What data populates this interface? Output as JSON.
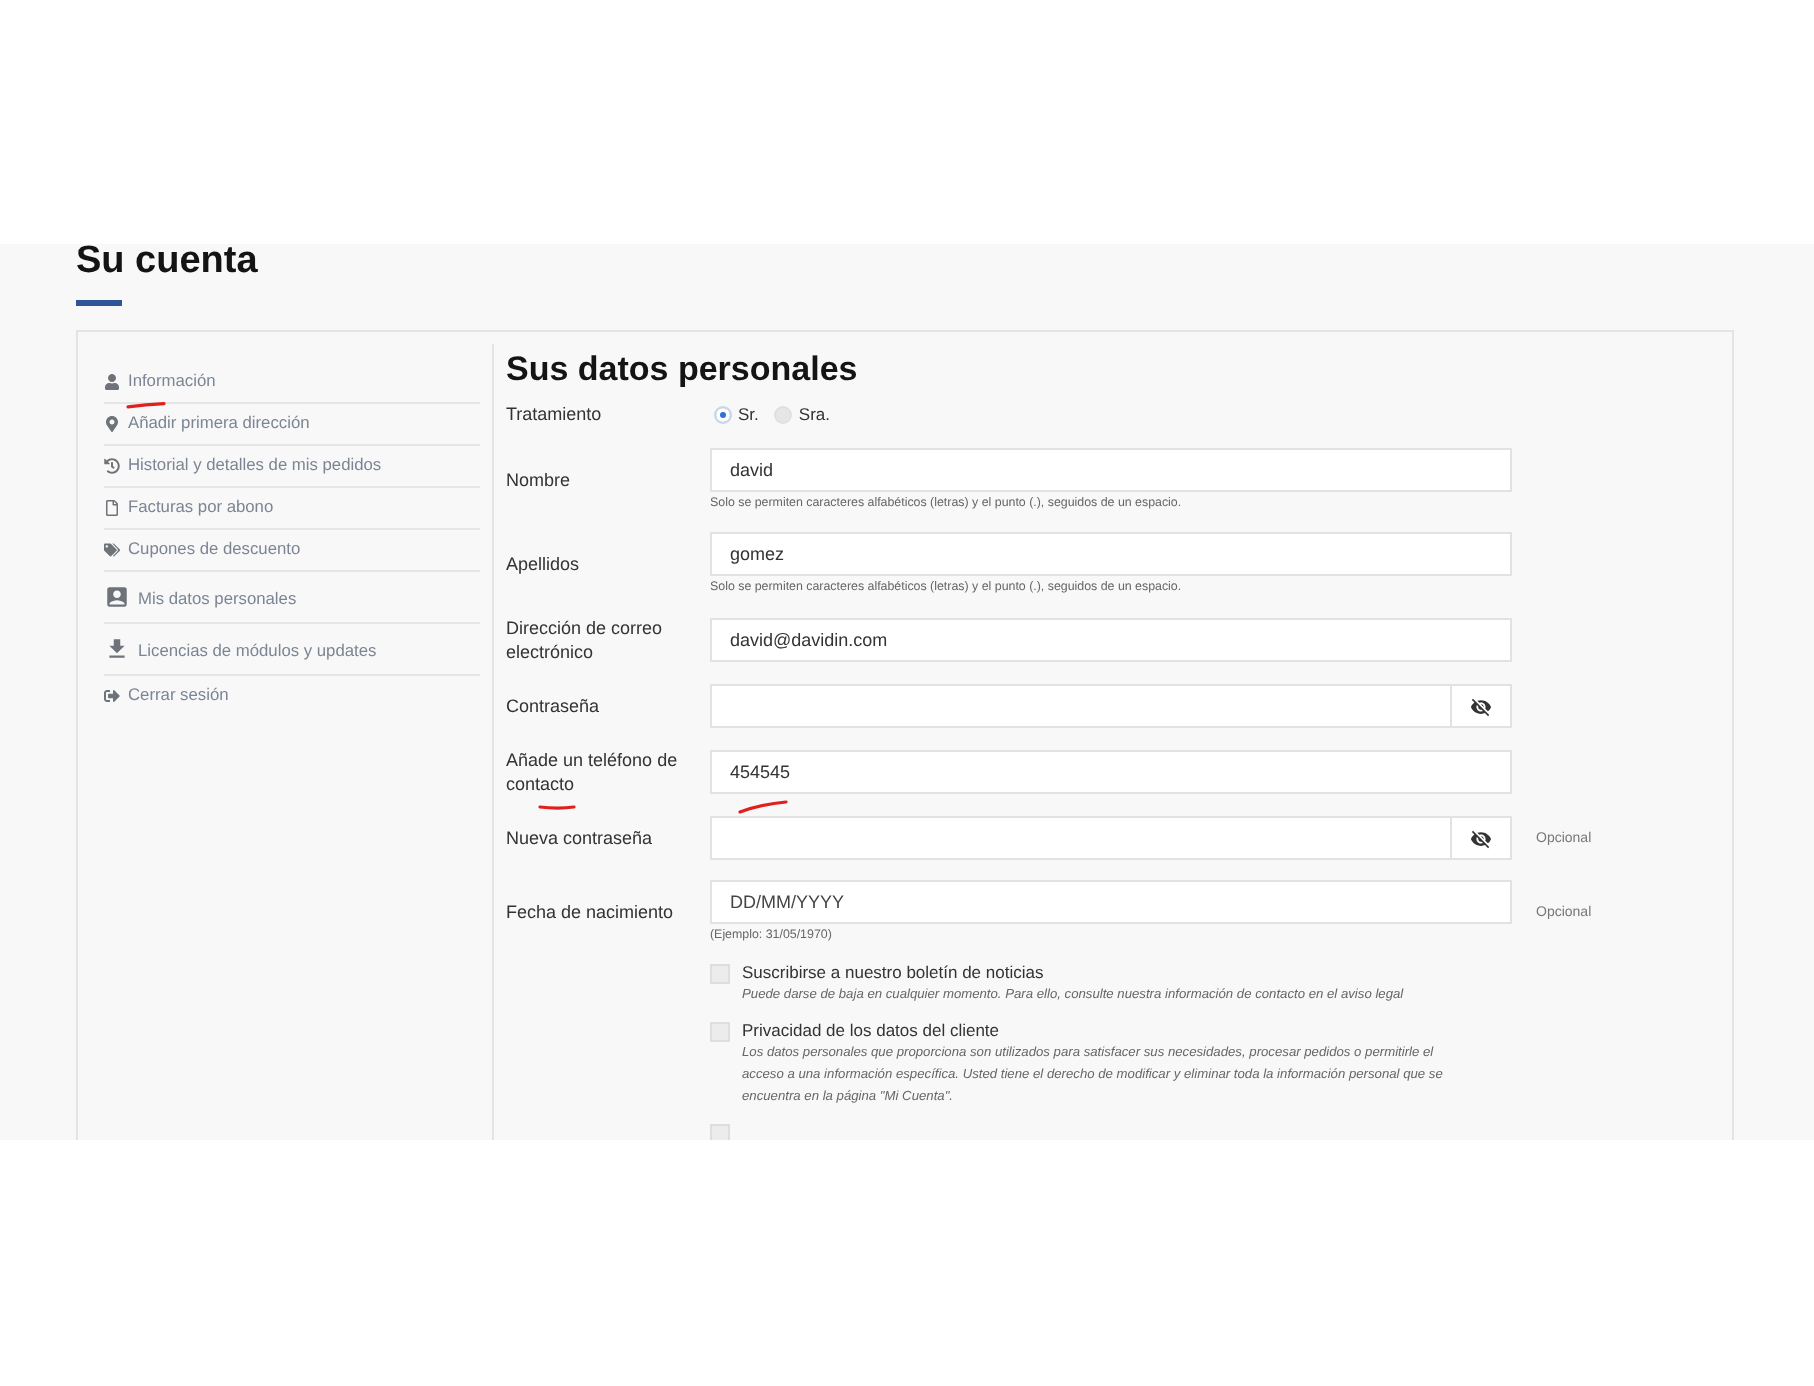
{
  "page_title": "Su cuenta",
  "sidebar": {
    "items": [
      {
        "label": "Información",
        "marked": true
      },
      {
        "label": "Añadir primera dirección",
        "marked": false
      },
      {
        "label": "Historial y detalles de mis pedidos",
        "marked": false
      },
      {
        "label": "Facturas por abono",
        "marked": false
      },
      {
        "label": "Cupones de descuento",
        "marked": false
      },
      {
        "label": "Mis datos personales",
        "marked": false
      },
      {
        "label": "Licencias de módulos y updates",
        "marked": false
      },
      {
        "label": "Cerrar sesión",
        "marked": false
      }
    ]
  },
  "form": {
    "title": "Sus datos personales",
    "fields": [
      {
        "kind": "radio",
        "label": "Tratamiento",
        "marked": false,
        "options": [
          {
            "label": "Sr.",
            "selected": true
          },
          {
            "label": "Sra.",
            "selected": false
          }
        ]
      },
      {
        "kind": "text",
        "label": "Nombre",
        "value": "david",
        "help": "Solo se permiten caracteres alfabéticos (letras) y el punto (.), seguidos de un espacio.",
        "marked": false
      },
      {
        "kind": "text",
        "label": "Apellidos",
        "value": "gomez",
        "help": "Solo se permiten caracteres alfabéticos (letras) y el punto (.), seguidos de un espacio.",
        "marked": false
      },
      {
        "kind": "text",
        "label": "Dirección de correo electrónico",
        "value": "david@davidin.com",
        "marked": false
      },
      {
        "kind": "password",
        "label": "Contraseña",
        "marked": false
      },
      {
        "kind": "text",
        "label": "Añade un teléfono de contacto",
        "value": "454545",
        "marked": true
      },
      {
        "kind": "password",
        "label": "Nueva contraseña",
        "note": "Opcional",
        "marked": false
      },
      {
        "kind": "text",
        "label": "Fecha de nacimiento",
        "placeholder": "DD/MM/YYYY",
        "help": "(Ejemplo: 31/05/1970)",
        "note": "Opcional",
        "marked": false
      }
    ]
  },
  "consents": [
    {
      "label": "Suscribirse a nuestro boletín de noticias",
      "description": "Puede darse de baja en cualquier momento. Para ello, consulte nuestra información de contacto en el aviso legal",
      "checked": false
    },
    {
      "label": "Privacidad de los datos del cliente",
      "description": "Los datos personales que proporciona son utilizados para satisfacer sus necesidades, procesar pedidos o permitirle el acceso a una información específica. Usted tiene el derecho de modificar y eliminar toda la información personal que se encuentra en la página \"Mi Cuenta\".",
      "checked": false
    },
    {
      "checked": false
    }
  ]
}
